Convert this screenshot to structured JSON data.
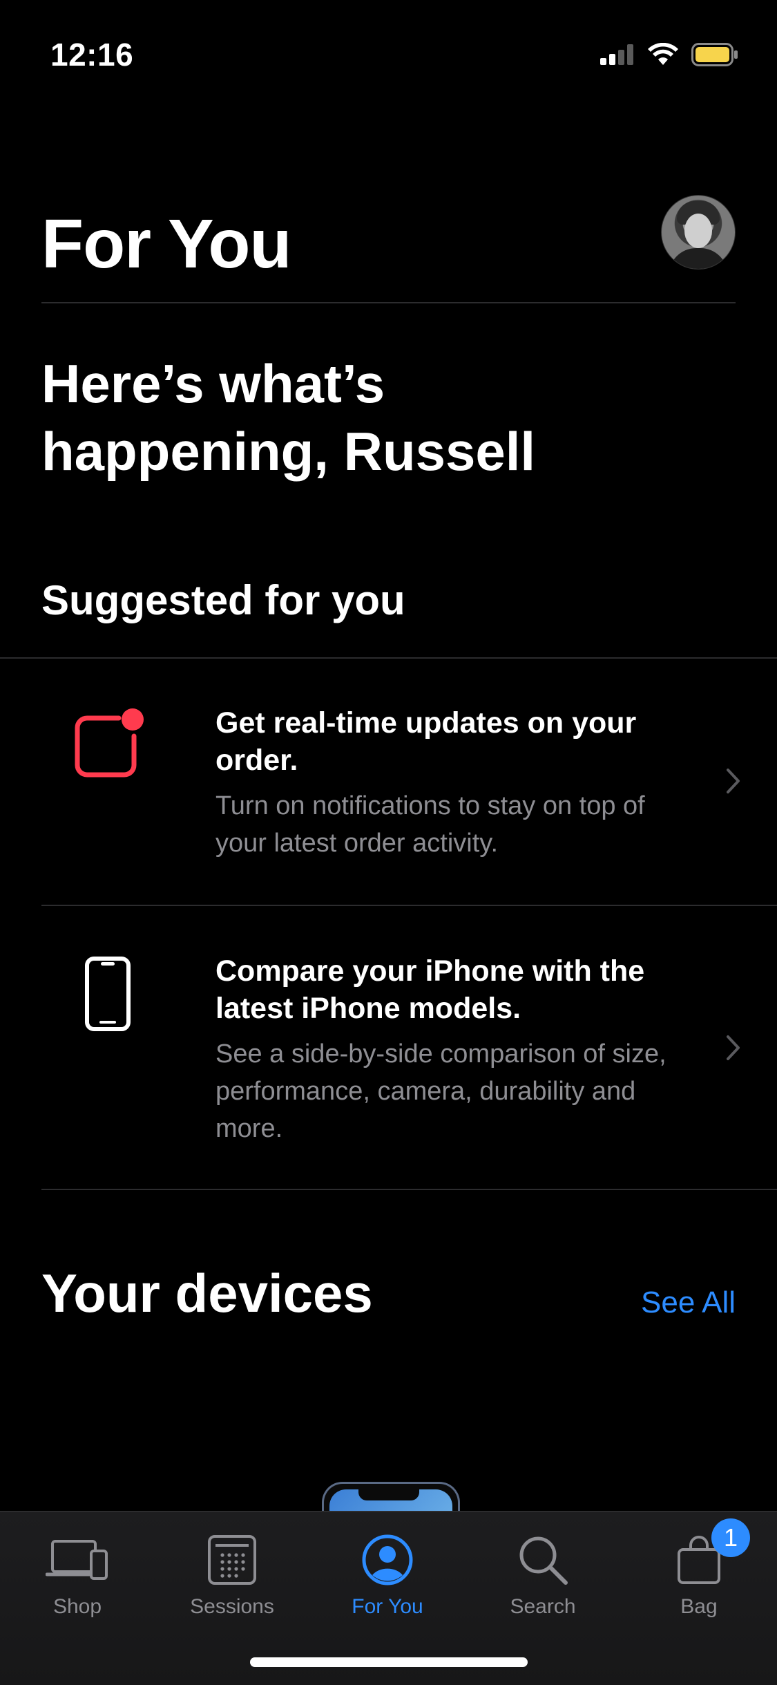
{
  "status_bar": {
    "time": "12:16"
  },
  "header": {
    "title": "For You"
  },
  "greeting": "Here’s what’s happening, Russell",
  "suggested": {
    "title": "Suggested for you",
    "items": [
      {
        "title": "Get real-time updates on your order.",
        "subtitle": "Turn on notifications to stay on top of your latest order activity.",
        "icon": "notification-badge-icon"
      },
      {
        "title": "Compare your iPhone with the latest iPhone models.",
        "subtitle": "See a side-by-side comparison of size, performance, camera, durability and more.",
        "icon": "iphone-icon"
      }
    ]
  },
  "devices": {
    "title": "Your devices",
    "see_all": "See All"
  },
  "tabbar": {
    "tabs": [
      {
        "label": "Shop",
        "icon": "devices-icon"
      },
      {
        "label": "Sessions",
        "icon": "calendar-icon"
      },
      {
        "label": "For You",
        "icon": "person-icon"
      },
      {
        "label": "Search",
        "icon": "search-icon"
      },
      {
        "label": "Bag",
        "icon": "bag-icon"
      }
    ],
    "active": "For You",
    "bag_badge": "1"
  },
  "colors": {
    "accent": "#2d8cff",
    "notification_red": "#ff3b4e",
    "secondary_text": "#8e8e93",
    "divider": "#2c2c2e"
  }
}
